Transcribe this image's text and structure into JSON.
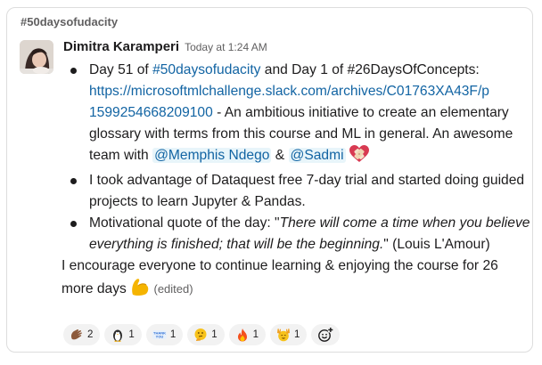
{
  "channel": "#50daysofudacity",
  "message": {
    "author": "Dimitra Karamperi",
    "timestamp": "Today at 1:24 AM",
    "item1": {
      "t1": "Day 51 of ",
      "hashtag": "#50daysofudacity",
      "t2": " and Day 1 of #26DaysOfConcepts:",
      "url_a": "https://microsoftmlchallenge.slack.com/archives/C01763XA43F/p",
      "url_b": "1599254668209100",
      "t3": " - An ambitious initiative to create an elementary glossary with terms from this course and ML in general. An awesome team with ",
      "mention1": "@Memphis Ndego",
      "t4": " & ",
      "mention2": "@Sadmi",
      "emoji": "heart-with-bandage"
    },
    "item2": "I took advantage of Dataquest free 7-day trial and started doing guided projects to learn Jupyter & Pandas.",
    "item3": {
      "t1": "Motivational quote of the day: \"",
      "quote": "There will come a time when you believe everything is finished; that will be the beginning.",
      "t2": "\" (Louis L'Amour)"
    },
    "closing": "I encourage everyone to continue learning & enjoying the course for 26 more days",
    "closing_emoji": "flexed-biceps",
    "edited": "(edited)"
  },
  "reactions": [
    {
      "icon": "clapping-hands-icon",
      "count": "2"
    },
    {
      "icon": "penguin-icon",
      "count": "1"
    },
    {
      "icon": "thank-you-icon",
      "count": "1"
    },
    {
      "icon": "thinking-face-icon",
      "count": "1"
    },
    {
      "icon": "fire-icon",
      "count": "1"
    },
    {
      "icon": "raised-hands-face-icon",
      "count": "1"
    }
  ],
  "thank_you_text": "THANK YOU",
  "colors": {
    "link": "#1264a3",
    "mention_bg": "#e8f5fa",
    "text": "#1d1c1d",
    "muted": "#616061"
  }
}
